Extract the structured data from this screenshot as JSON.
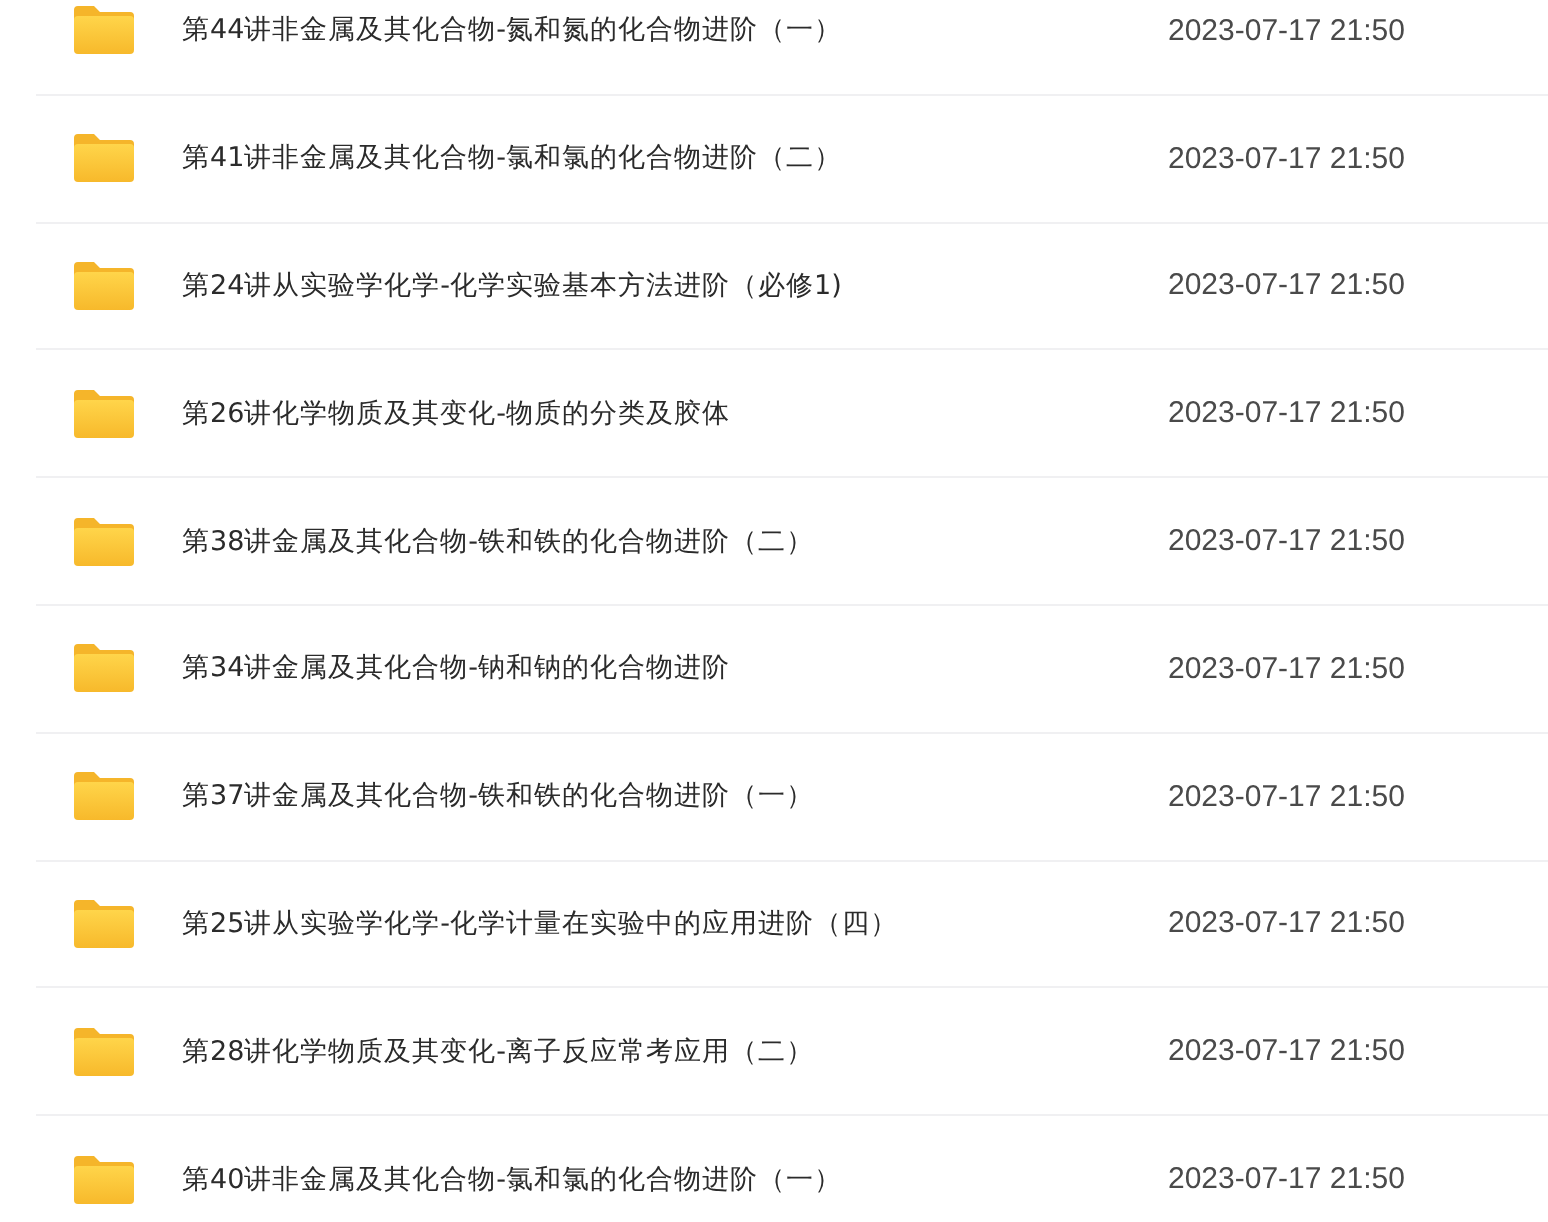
{
  "files": [
    {
      "name": "第44讲非金属及其化合物-氮和氮的化合物进阶（一）",
      "modified": "2023-07-17 21:50"
    },
    {
      "name": "第41讲非金属及其化合物-氯和氯的化合物进阶（二）",
      "modified": "2023-07-17 21:50"
    },
    {
      "name": "第24讲从实验学化学-化学实验基本方法进阶（必修1)",
      "modified": "2023-07-17 21:50"
    },
    {
      "name": "第26讲化学物质及其变化-物质的分类及胶体",
      "modified": "2023-07-17 21:50"
    },
    {
      "name": "第38讲金属及其化合物-铁和铁的化合物进阶（二）",
      "modified": "2023-07-17 21:50"
    },
    {
      "name": "第34讲金属及其化合物-钠和钠的化合物进阶",
      "modified": "2023-07-17 21:50"
    },
    {
      "name": "第37讲金属及其化合物-铁和铁的化合物进阶（一）",
      "modified": "2023-07-17 21:50"
    },
    {
      "name": "第25讲从实验学化学-化学计量在实验中的应用进阶（四）",
      "modified": "2023-07-17 21:50"
    },
    {
      "name": "第28讲化学物质及其变化-离子反应常考应用（二）",
      "modified": "2023-07-17 21:50"
    },
    {
      "name": "第40讲非金属及其化合物-氯和氯的化合物进阶（一）",
      "modified": "2023-07-17 21:50"
    }
  ]
}
